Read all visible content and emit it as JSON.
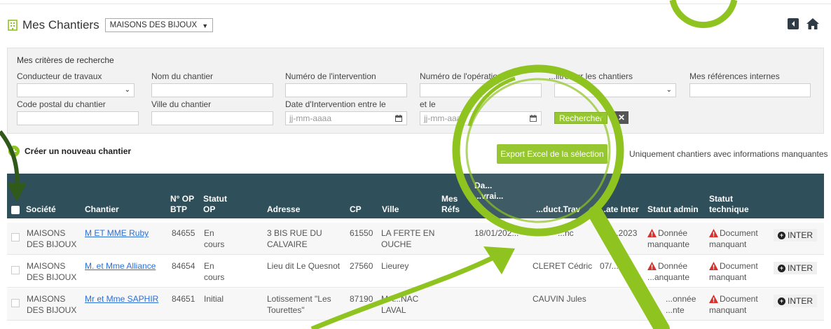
{
  "header": {
    "title": "Mes Chantiers",
    "company_select": "MAISONS DES BIJOUX"
  },
  "criteria": {
    "title": "Mes critères de recherche",
    "labels": {
      "conducteur": "Conducteur de travaux",
      "nom_chantier": "Nom du chantier",
      "num_intervention": "Numéro de l'intervention",
      "num_operation": "Numéro de l'opération",
      "filtre": "...iltre sur les chantiers",
      "refs_internes": "Mes références internes",
      "code_postal": "Code postal du chantier",
      "ville": "Ville du chantier",
      "date_entre": "Date d'Intervention entre le",
      "et_le": "et le"
    },
    "date_placeholder_1": "jj-mm-aaaa",
    "date_placeholder_2": "jj-mm-aaaa",
    "search_label": "Rechercher",
    "clear_label": "✕"
  },
  "actions": {
    "create_label": "Créer un nouveau chantier",
    "export_label": "Export Excel de la sélection",
    "only_missing_label": "Uniquement chantiers avec informations manquantes"
  },
  "table": {
    "headers": {
      "societe": "Société",
      "chantier": "Chantier",
      "nop_1": "N° OP",
      "nop_2": "BTP",
      "statut_op_1": "Statut",
      "statut_op_2": "OP",
      "adresse": "Adresse",
      "cp": "CP",
      "ville": "Ville",
      "refs_1": "Mes",
      "refs_2": "Réfs",
      "livraison_1": "Da...",
      "livraison_2": "...vrai...",
      "conduct": "...duct.Trav",
      "date_inter": "...ate Inter",
      "statut_admin": "Statut admin",
      "statut_tech_1": "Statut",
      "statut_tech_2": "technique"
    },
    "rows": [
      {
        "societe_1": "MAISONS",
        "societe_2": "DES BIJOUX",
        "chantier": "M ET MME Ruby",
        "nop": "84655",
        "statut_1": "En",
        "statut_2": "cours",
        "adresse_1": "3 BIS RUE DU",
        "adresse_2": "CALVAIRE",
        "cp": "61550",
        "ville_1": "LA FERTE EN",
        "ville_2": "OUCHE",
        "livraison": "18/01/202...",
        "conduct": "...nc",
        "date_inter": "07/...2023",
        "admin_1": "Donnée",
        "admin_2": "manquante",
        "tech_1": "Document",
        "tech_2": "manquant",
        "inter": "INTER"
      },
      {
        "societe_1": "MAISONS",
        "societe_2": "DES BIJOUX",
        "chantier": "M. et Mme Alliance",
        "nop": "84654",
        "statut_1": "En",
        "statut_2": "cours",
        "adresse_1": "Lieu dit Le Quesnot",
        "adresse_2": "",
        "cp": "27560",
        "ville_1": "Lieurey",
        "ville_2": "",
        "livraison": "",
        "conduct": "CLERET Cédric",
        "date_inter": "07/...",
        "admin_1": "Donnée",
        "admin_2": "...anquante",
        "tech_1": "Document",
        "tech_2": "manquant",
        "inter": "INTER"
      },
      {
        "societe_1": "MAISONS",
        "societe_2": "DES BIJOUX",
        "chantier": "Mr et Mme SAPHIR",
        "nop": "84651",
        "statut_1": "Initial",
        "statut_2": "",
        "adresse_1": "Lotissement \"Les",
        "adresse_2": "Tourettes\"",
        "cp": "87190",
        "ville_1": "MA...NAC",
        "ville_2": "LAVAL",
        "livraison": "",
        "conduct": "CAUVIN Jules",
        "date_inter": "",
        "admin_1": "...onnée",
        "admin_2": "...nte",
        "tech_1": "Document",
        "tech_2": "manquant",
        "inter": "INTER"
      }
    ]
  },
  "colors": {
    "accent_green": "#8fc31f",
    "header_dark": "#2f4f5a",
    "warn_red": "#d9302c",
    "link_blue": "#2b6fd6",
    "annotation_green": "#8fc31f"
  }
}
